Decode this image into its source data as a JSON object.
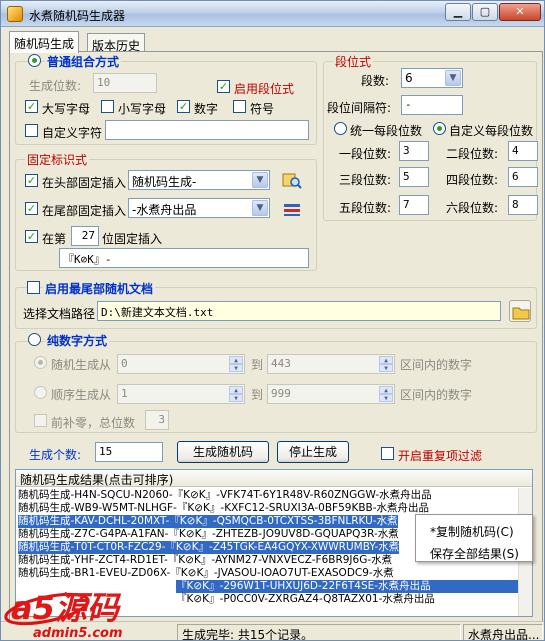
{
  "window": {
    "title": "水煮随机码生成器",
    "min_label": "▁",
    "max_label": "▢",
    "close_label": "✕"
  },
  "tabs": [
    "随机码生成",
    "版本历史"
  ],
  "normal": {
    "title": "普通组合方式",
    "length_label": "生成位数:",
    "length_value": "10",
    "enable_seg_label": "启用段位式",
    "enable_seg_checked": true,
    "upper_label": "大写字母",
    "upper_checked": true,
    "lower_label": "小写字母",
    "lower_checked": false,
    "digit_label": "数字",
    "digit_checked": true,
    "symbol_label": "符号",
    "symbol_checked": false,
    "custom_label": "自定义字符",
    "custom_checked": false,
    "custom_value": ""
  },
  "segment": {
    "title": "段位式",
    "count_label": "段数:",
    "count_value": "6",
    "sep_label": "段位间隔符:",
    "sep_value": "-",
    "uniform_label": "统一每段位数",
    "custom_label": "自定义每段位数",
    "items": [
      {
        "label": "一段位数:",
        "value": "3"
      },
      {
        "label": "二段位数:",
        "value": "4"
      },
      {
        "label": "三段位数:",
        "value": "5"
      },
      {
        "label": "四段位数:",
        "value": "6"
      },
      {
        "label": "五段位数:",
        "value": "7"
      },
      {
        "label": "六段位数:",
        "value": "8"
      }
    ]
  },
  "fixed": {
    "title": "固定标识式",
    "head_label": "在头部固定插入",
    "head_value": "随机码生成-",
    "tail_label": "在尾部固定插入",
    "tail_value": "-水煮舟出品",
    "pos_prefix": "在第",
    "pos_value": "27",
    "pos_suffix": "位固定插入",
    "pos_text": "『K⊘K』-"
  },
  "doc": {
    "title": "启用最尾部随机文档",
    "path_label": "选择文档路径",
    "path_value": "D:\\新建文本文档.txt"
  },
  "pure": {
    "title": "纯数字方式",
    "random_label": "随机生成从",
    "random_from": "0",
    "random_to": "443",
    "seq_label": "顺序生成从",
    "seq_from": "1",
    "seq_to": "999",
    "to_label": "到",
    "range_label": "区间内的数字",
    "pad_label": "前补零，总位数",
    "pad_value": "3"
  },
  "actions": {
    "count_label": "生成个数:",
    "count_value": "15",
    "generate_label": "生成随机码",
    "stop_label": "停止生成",
    "dedupe_label": "开启重复项过滤"
  },
  "results": {
    "header": "随机码生成结果(点击可排序)",
    "rows": [
      "随机码生成-H4N-SQCU-N2060-『K⊘K』-VFK74T-6Y1R48V-R60ZNGGW-水煮舟出品",
      "随机码生成-WB9-W5MT-NLHGF-『K⊘K』-KXFC12-SRUXI3A-0BF59KBB-水煮舟出品",
      "随机码生成-KAV-DCHL-20MXT-『K⊘K』-QSMQCB-0TCXTSS-3BFNLRKU-水煮",
      "随机码生成-Z7C-G4PA-A1FAN-『K⊘K』-ZHTEZB-JO9UV8D-GQUAPQ3R-水煮",
      "随机码生成-T0T-CT0R-FZC29-『K⊘K』-Z45TGK-EA4GQYX-XWWRUMBY-水煮",
      "随机码生成-YHF-ZCT4-RD1ET-『K⊘K』-AYNM27-VNXVECZ-F6BR9J6G-水煮",
      "随机码生成-BR1-EVEU-ZD06X-『K⊘K』-JVASOU-IOAO7UT-EXASODC9-水煮",
      "『K⊘K』-296W1T-UHXUJ6D-22F6T4SE-水煮舟出品",
      "『K⊘K』-P0CC0V-ZXRGAZ4-Q8TAZX01-水煮舟出品"
    ]
  },
  "context_menu": {
    "items": [
      "*复制随机码(C)",
      "保存全部结果(S)"
    ]
  },
  "status": {
    "left": "生成完毕: 共15个记录。",
    "right": "水煮舟出品..."
  },
  "watermark": {
    "brand": "a5源码",
    "site": "admin5.com"
  }
}
